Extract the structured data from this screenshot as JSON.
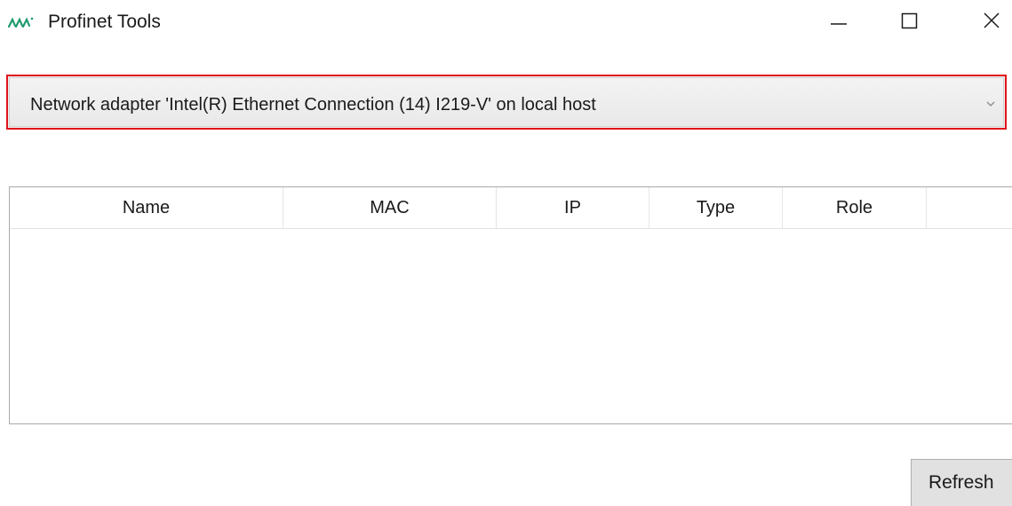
{
  "window": {
    "title": "Profinet Tools",
    "logo_icon": "profinet-logo-icon",
    "controls": {
      "minimize_icon": "minimize-icon",
      "maximize_icon": "maximize-icon",
      "close_icon": "close-icon"
    }
  },
  "adapter": {
    "selected": "Network adapter 'Intel(R) Ethernet Connection (14) I219-V' on local host",
    "dropdown_icon": "chevron-down-icon"
  },
  "table": {
    "columns": [
      "Name",
      "MAC",
      "IP",
      "Type",
      "Role"
    ],
    "rows": []
  },
  "actions": {
    "refresh_label": "Refresh"
  },
  "colors": {
    "focus_border": "#e0141a",
    "logo": "#1f9b6e",
    "button_bg": "#e1e1e1"
  }
}
